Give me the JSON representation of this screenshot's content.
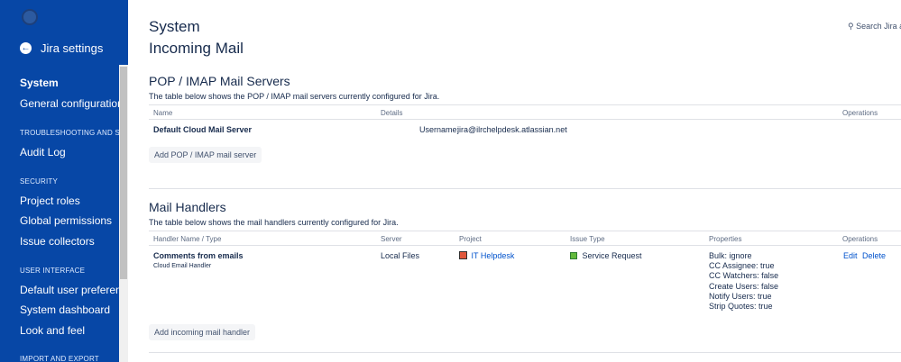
{
  "sidebar": {
    "back_label": "Jira settings",
    "items": [
      {
        "label": "System",
        "active": true
      },
      {
        "label": "General configuration"
      }
    ],
    "sections": [
      {
        "title": "TROUBLESHOOTING AND SUPP...",
        "items": [
          "Audit Log"
        ]
      },
      {
        "title": "SECURITY",
        "items": [
          "Project roles",
          "Global permissions",
          "Issue collectors"
        ]
      },
      {
        "title": "USER INTERFACE",
        "items": [
          "Default user preferences",
          "System dashboard",
          "Look and feel"
        ]
      },
      {
        "title": "IMPORT AND EXPORT",
        "items": []
      }
    ]
  },
  "header": {
    "section_title": "System",
    "page_title": "Incoming Mail",
    "search_placeholder": "Search Jira ad"
  },
  "pop_imap": {
    "heading": "POP / IMAP Mail Servers",
    "description": "The table below shows the POP / IMAP mail servers currently configured for Jira.",
    "columns": [
      "Name",
      "Details",
      "Operations"
    ],
    "row": {
      "name": "Default Cloud Mail Server",
      "username_label": "Username:",
      "username_value": "jira@ilrchelpdesk.atlassian.net"
    },
    "add_button": "Add POP / IMAP mail server"
  },
  "mail_handlers": {
    "heading": "Mail Handlers",
    "description": "The table below shows the mail handlers currently configured for Jira.",
    "columns": [
      "Handler Name / Type",
      "Server",
      "Project",
      "Issue Type",
      "Properties",
      "Operations"
    ],
    "row": {
      "name": "Comments from emails",
      "type": "Cloud Email Handler",
      "server": "Local Files",
      "project": "IT Helpdesk",
      "issue_type": "Service Request",
      "properties": [
        "Bulk: ignore",
        "CC Assignee: true",
        "CC Watchers: false",
        "Create Users: false",
        "Notify Users: true",
        "Strip Quotes: true"
      ],
      "edit": "Edit",
      "delete": "Delete"
    },
    "add_button": "Add incoming mail handler"
  },
  "colors": {
    "sidebar_bg": "#0747a6",
    "link": "#0052cc"
  }
}
